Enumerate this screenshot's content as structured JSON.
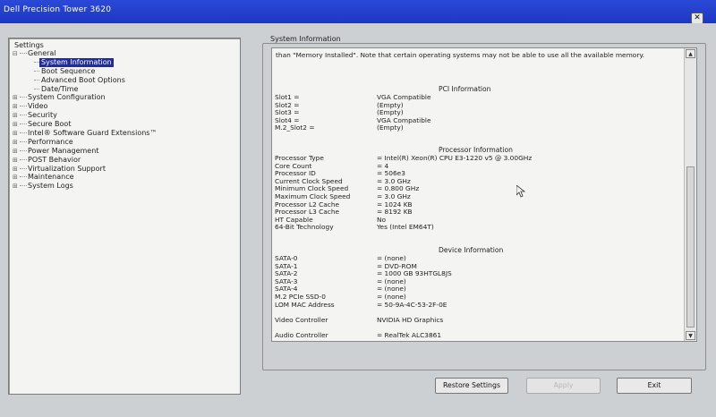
{
  "window": {
    "title": "Dell Precision Tower 3620",
    "close_label": "✕"
  },
  "tree": {
    "root_label": "Settings",
    "items": [
      {
        "label": "General",
        "level": 0,
        "expander": "⊟"
      },
      {
        "label": "System Information",
        "level": 1,
        "selected": true
      },
      {
        "label": "Boot Sequence",
        "level": 1
      },
      {
        "label": "Advanced Boot Options",
        "level": 1
      },
      {
        "label": "Date/Time",
        "level": 1
      },
      {
        "label": "System Configuration",
        "level": 0,
        "expander": "⊞"
      },
      {
        "label": "Video",
        "level": 0,
        "expander": "⊞"
      },
      {
        "label": "Security",
        "level": 0,
        "expander": "⊞"
      },
      {
        "label": "Secure Boot",
        "level": 0,
        "expander": "⊞"
      },
      {
        "label": "Intel® Software Guard Extensions™",
        "level": 0,
        "expander": "⊞"
      },
      {
        "label": "Performance",
        "level": 0,
        "expander": "⊞"
      },
      {
        "label": "Power Management",
        "level": 0,
        "expander": "⊞"
      },
      {
        "label": "POST Behavior",
        "level": 0,
        "expander": "⊞"
      },
      {
        "label": "Virtualization Support",
        "level": 0,
        "expander": "⊞"
      },
      {
        "label": "Maintenance",
        "level": 0,
        "expander": "⊞"
      },
      {
        "label": "System Logs",
        "level": 0,
        "expander": "⊞"
      }
    ]
  },
  "group": {
    "title": "System Information",
    "note": "than \"Memory Installed\". Note that certain operating systems may not be able to use all the available memory.",
    "pci": {
      "title": "PCI Information",
      "rows": [
        {
          "k": "Slot1 =",
          "v": "VGA Compatible"
        },
        {
          "k": "Slot2 =",
          "v": "(Empty)"
        },
        {
          "k": "Slot3 =",
          "v": "(Empty)"
        },
        {
          "k": "Slot4 =",
          "v": "VGA Compatible"
        },
        {
          "k": "M.2_Slot2 =",
          "v": "(Empty)"
        }
      ]
    },
    "processor": {
      "title": "Processor Information",
      "rows": [
        {
          "k": "Processor Type",
          "v": "= Intel(R) Xeon(R) CPU E3-1220 v5 @ 3.00GHz"
        },
        {
          "k": "Core Count",
          "v": "= 4"
        },
        {
          "k": "Processor ID",
          "v": "= 506e3"
        },
        {
          "k": "Current Clock Speed",
          "v": "= 3.0 GHz"
        },
        {
          "k": "Minimum Clock Speed",
          "v": "= 0.800 GHz"
        },
        {
          "k": "Maximum Clock Speed",
          "v": "= 3.0 GHz"
        },
        {
          "k": "Processor L2 Cache",
          "v": "= 1024 KB"
        },
        {
          "k": "Processor L3 Cache",
          "v": "= 8192 KB"
        },
        {
          "k": "HT Capable",
          "v": "No"
        },
        {
          "k": "64-Bit Technology",
          "v": "Yes (Intel EM64T)"
        }
      ]
    },
    "device": {
      "title": "Device Information",
      "rows": [
        {
          "k": "SATA-0",
          "v": "= (none)"
        },
        {
          "k": "SATA-1",
          "v": "= DVD-ROM"
        },
        {
          "k": "SATA-2",
          "v": "= 1000 GB 93HTGL8JS"
        },
        {
          "k": "SATA-3",
          "v": "= (none)"
        },
        {
          "k": "SATA-4",
          "v": "= (none)"
        },
        {
          "k": "M.2 PCIe SSD-0",
          "v": "= (none)"
        },
        {
          "k": "LOM MAC Address",
          "v": "= 50-9A-4C-53-2F-0E"
        }
      ],
      "video_controller": {
        "k": "Video Controller",
        "v": "NVIDIA HD Graphics"
      },
      "audio_controller": {
        "k": "Audio Controller",
        "v": "= RealTek ALC3861"
      }
    }
  },
  "buttons": {
    "restore": "Restore Settings",
    "apply": "Apply",
    "exit": "Exit"
  },
  "colors": {
    "titlebar": "#1d37c4",
    "selected_bg": "#1f2c9a",
    "background": "#cdd0d2"
  }
}
